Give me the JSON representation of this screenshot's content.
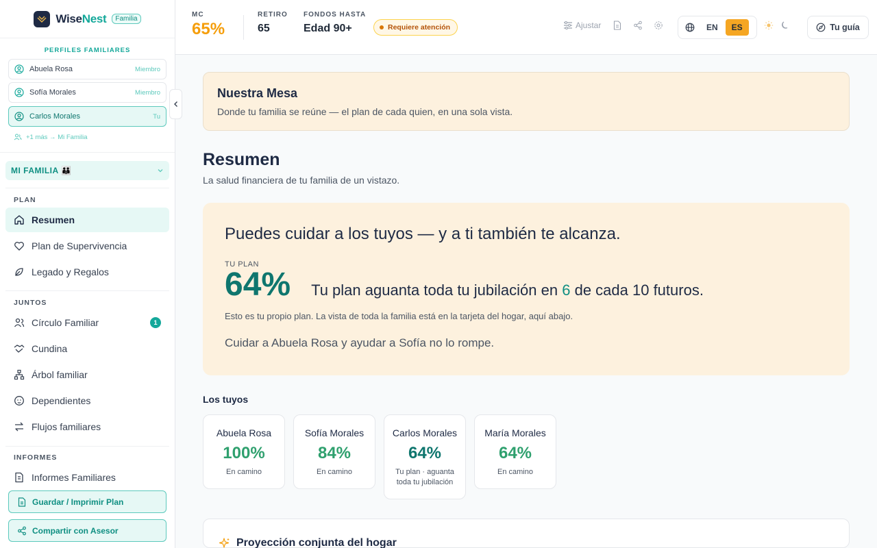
{
  "brand": {
    "wise": "Wise",
    "nest": "Nest",
    "badge": "Familia"
  },
  "sidebar": {
    "profiles_heading": "PERFILES FAMILIARES",
    "profiles": [
      {
        "name": "Abuela Rosa",
        "role": "Miembro"
      },
      {
        "name": "Sofía Morales",
        "role": "Miembro"
      },
      {
        "name": "Carlos Morales",
        "role": "Tu"
      }
    ],
    "more_link": "+1 más → Mi Familia",
    "family_pill": "MI FAMILIA 👪",
    "sections": {
      "plan": "PLAN",
      "juntos": "JUNTOS",
      "informes": "INFORMES"
    },
    "nav": {
      "resumen": "Resumen",
      "supervivencia": "Plan de Supervivencia",
      "legado": "Legado y Regalos",
      "circulo": "Círculo Familiar",
      "circulo_badge": "1",
      "cundina": "Cundina",
      "arbol": "Árbol familiar",
      "dependientes": "Dependientes",
      "flujos": "Flujos familiares",
      "informes_fam": "Informes Familiares"
    },
    "buttons": {
      "guardar": "Guardar / Imprimir Plan",
      "compartir": "Compartir con Asesor"
    }
  },
  "header": {
    "mc_label": "MC",
    "mc_value": "65%",
    "retiro_label": "RETIRO",
    "retiro_value": "65",
    "fondos_label": "FONDOS HASTA",
    "fondos_value": "Edad 90+",
    "attention": "Requiere atención",
    "ajustar": "Ajustar",
    "lang_en": "EN",
    "lang_es": "ES",
    "guide": "Tu guía"
  },
  "main": {
    "mesa_title": "Nuestra Mesa",
    "mesa_sub": "Donde tu familia se reúne — el plan de cada quien, en una sola vista.",
    "resumen_title": "Resumen",
    "resumen_sub": "La salud financiera de tu familia de un vistazo.",
    "hero": {
      "headline": "Puedes cuidar a los tuyos — y a ti también te alcanza.",
      "plan_label": "TU PLAN",
      "plan_value": "64%",
      "line_a": "Tu plan aguanta toda tu jubilación en ",
      "line_num": "6",
      "line_b": " de cada 10 futuros.",
      "note": "Esto es tu propio plan. La vista de toda la familia está en la tarjeta del hogar, aquí abajo.",
      "care": "Cuidar a Abuela Rosa y ayudar a Sofía no lo rompe."
    },
    "tuyos_title": "Los tuyos",
    "members": [
      {
        "name": "Abuela Rosa",
        "pct": "100%",
        "status": "En camino"
      },
      {
        "name": "Sofía Morales",
        "pct": "84%",
        "status": "En camino"
      },
      {
        "name": "Carlos Morales",
        "pct": "64%",
        "status": "Tu plan · aguanta toda tu jubilación"
      },
      {
        "name": "María Morales",
        "pct": "64%",
        "status": "En camino"
      }
    ],
    "projection_title": "Proyección conjunta del hogar"
  },
  "colors": {
    "accent": "#14a89a",
    "warning": "#f59e0b",
    "cream": "#fdf1de",
    "navy": "#1e2a44"
  }
}
